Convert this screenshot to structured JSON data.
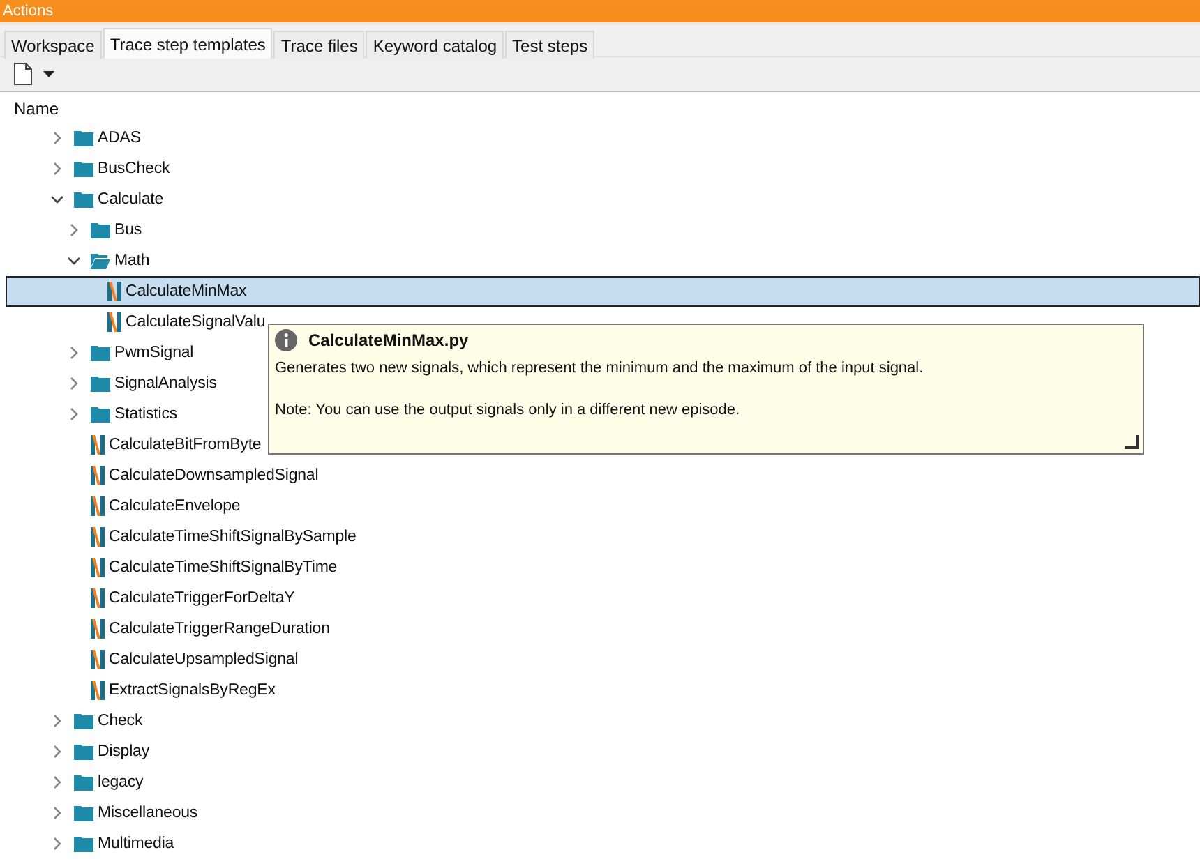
{
  "window": {
    "title": "Actions"
  },
  "tabs": [
    {
      "label": "Workspace",
      "selected": false
    },
    {
      "label": "Trace step templates",
      "selected": true
    },
    {
      "label": "Trace files",
      "selected": false
    },
    {
      "label": "Keyword catalog",
      "selected": false
    },
    {
      "label": "Test steps",
      "selected": false
    }
  ],
  "tree": {
    "column": "Name",
    "items": [
      {
        "kind": "folder",
        "label": "ADAS",
        "expanded": false,
        "selected": false
      },
      {
        "kind": "folder",
        "label": "BusCheck",
        "expanded": false,
        "selected": false
      },
      {
        "kind": "folder",
        "label": "Calculate",
        "expanded": true,
        "selected": false,
        "children": [
          {
            "kind": "folder",
            "label": "Bus",
            "expanded": false,
            "selected": false
          },
          {
            "kind": "folder",
            "label": "Math",
            "expanded": true,
            "selected": false,
            "children": [
              {
                "kind": "script",
                "label": "CalculateMinMax",
                "selected": true
              },
              {
                "kind": "script",
                "label": "CalculateSignalValu",
                "selected": false
              }
            ]
          },
          {
            "kind": "folder",
            "label": "PwmSignal",
            "expanded": false,
            "selected": false
          },
          {
            "kind": "folder",
            "label": "SignalAnalysis",
            "expanded": false,
            "selected": false
          },
          {
            "kind": "folder",
            "label": "Statistics",
            "expanded": false,
            "selected": false
          },
          {
            "kind": "script",
            "label": "CalculateBitFromByte",
            "selected": false
          },
          {
            "kind": "script",
            "label": "CalculateDownsampledSignal",
            "selected": false
          },
          {
            "kind": "script",
            "label": "CalculateEnvelope",
            "selected": false
          },
          {
            "kind": "script",
            "label": "CalculateTimeShiftSignalBySample",
            "selected": false
          },
          {
            "kind": "script",
            "label": "CalculateTimeShiftSignalByTime",
            "selected": false
          },
          {
            "kind": "script",
            "label": "CalculateTriggerForDeltaY",
            "selected": false
          },
          {
            "kind": "script",
            "label": "CalculateTriggerRangeDuration",
            "selected": false
          },
          {
            "kind": "script",
            "label": "CalculateUpsampledSignal",
            "selected": false
          },
          {
            "kind": "script",
            "label": "ExtractSignalsByRegEx",
            "selected": false
          }
        ]
      },
      {
        "kind": "folder",
        "label": "Check",
        "expanded": false,
        "selected": false
      },
      {
        "kind": "folder",
        "label": "Display",
        "expanded": false,
        "selected": false
      },
      {
        "kind": "folder",
        "label": "legacy",
        "expanded": false,
        "selected": false
      },
      {
        "kind": "folder",
        "label": "Miscellaneous",
        "expanded": false,
        "selected": false
      },
      {
        "kind": "folder",
        "label": "Multimedia",
        "expanded": false,
        "selected": false
      }
    ]
  },
  "tooltip": {
    "title": "CalculateMinMax.py",
    "lines": [
      "Generates two new signals, which represent the minimum and the maximum of the input signal.",
      "Note: You can use the output signals only in a different new episode."
    ]
  }
}
